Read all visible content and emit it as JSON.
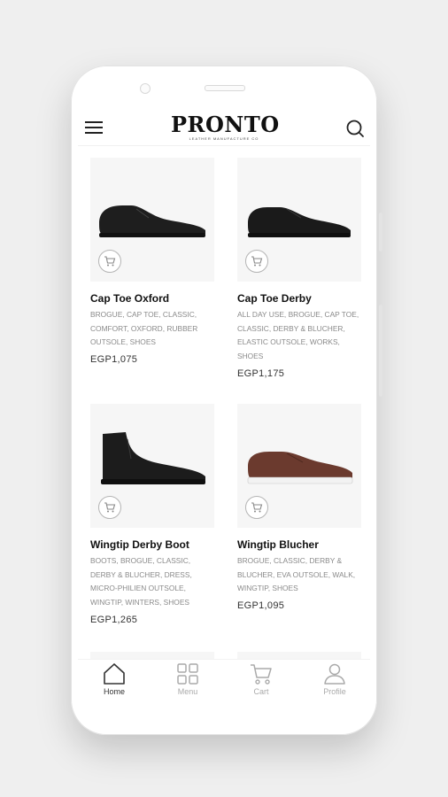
{
  "app": {
    "logo": "PRONTO",
    "logo_tagline": "LEATHER MANUFACTURE CO"
  },
  "products": [
    {
      "name": "Cap Toe Oxford",
      "tags": "BROGUE, CAP TOE, CLASSIC, COMFORT, OXFORD, RUBBER OUTSOLE, SHOES",
      "price": "EGP1,075",
      "shoe_color": "#1e1e1e"
    },
    {
      "name": "Cap Toe Derby",
      "tags": "ALL DAY USE, BROGUE, CAP TOE, CLASSIC, DERBY & BLUCHER, ELASTIC OUTSOLE, WORKS, SHOES",
      "price": "EGP1,175",
      "shoe_color": "#1a1a1a"
    },
    {
      "name": "Wingtip Derby Boot",
      "tags": "BOOTS, BROGUE, CLASSIC, DERBY & BLUCHER, DRESS, MICRO-PHILIEN OUTSOLE, WINGTIP, WINTERS, SHOES",
      "price": "EGP1,265",
      "shoe_color": "#1c1c1c"
    },
    {
      "name": "Wingtip Blucher",
      "tags": "BROGUE, CLASSIC, DERBY & BLUCHER, EVA OUTSOLE, WALK, WINGTIP, SHOES",
      "price": "EGP1,095",
      "shoe_color": "#6b3a2e"
    }
  ],
  "nav": {
    "home": "Home",
    "menu": "Menu",
    "cart": "Cart",
    "profile": "Profile"
  },
  "icons": {
    "menu": "hamburger-icon",
    "search": "search-icon",
    "add_to_cart": "cart-icon",
    "home": "home-icon",
    "grid": "grid-icon",
    "cart": "cart-icon",
    "profile": "user-icon"
  }
}
